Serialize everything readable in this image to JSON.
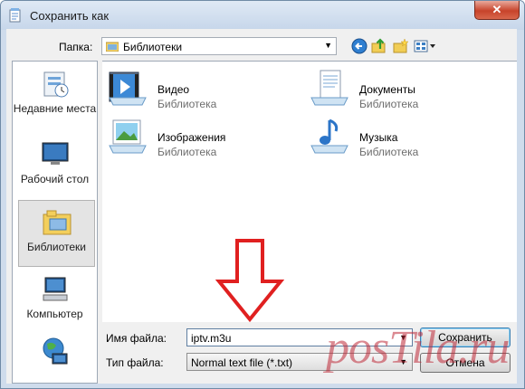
{
  "window": {
    "title": "Сохранить как",
    "close_label": "✕"
  },
  "folder": {
    "label": "Папка:",
    "value": "Библиотеки"
  },
  "toolbar": [
    "back",
    "up",
    "new-folder",
    "views"
  ],
  "places": [
    {
      "label": "Недавние места",
      "icon": "recent-places-icon"
    },
    {
      "label": "Рабочий стол",
      "icon": "desktop-icon"
    },
    {
      "label": "Библиотеки",
      "icon": "libraries-icon",
      "selected": true
    },
    {
      "label": "Компьютер",
      "icon": "computer-icon"
    },
    {
      "label": "",
      "icon": "network-icon"
    }
  ],
  "libraries": [
    {
      "name": "Видео",
      "sub": "Библиотека",
      "icon": "video-library-icon"
    },
    {
      "name": "Документы",
      "sub": "Библиотека",
      "icon": "documents-library-icon"
    },
    {
      "name": "Изображения",
      "sub": "Библиотека",
      "icon": "pictures-library-icon"
    },
    {
      "name": "Музыка",
      "sub": "Библиотека",
      "icon": "music-library-icon"
    }
  ],
  "form": {
    "filename_label": "Имя файла:",
    "filename_value": "iptv.m3u",
    "filetype_label": "Тип файла:",
    "filetype_value": "Normal text file (*.txt)",
    "save_label": "Сохранить",
    "cancel_label": "Отмена"
  },
  "watermark": "posTila.ru",
  "colors": {
    "arrow": "#e02020",
    "watermark": "#be2837"
  }
}
